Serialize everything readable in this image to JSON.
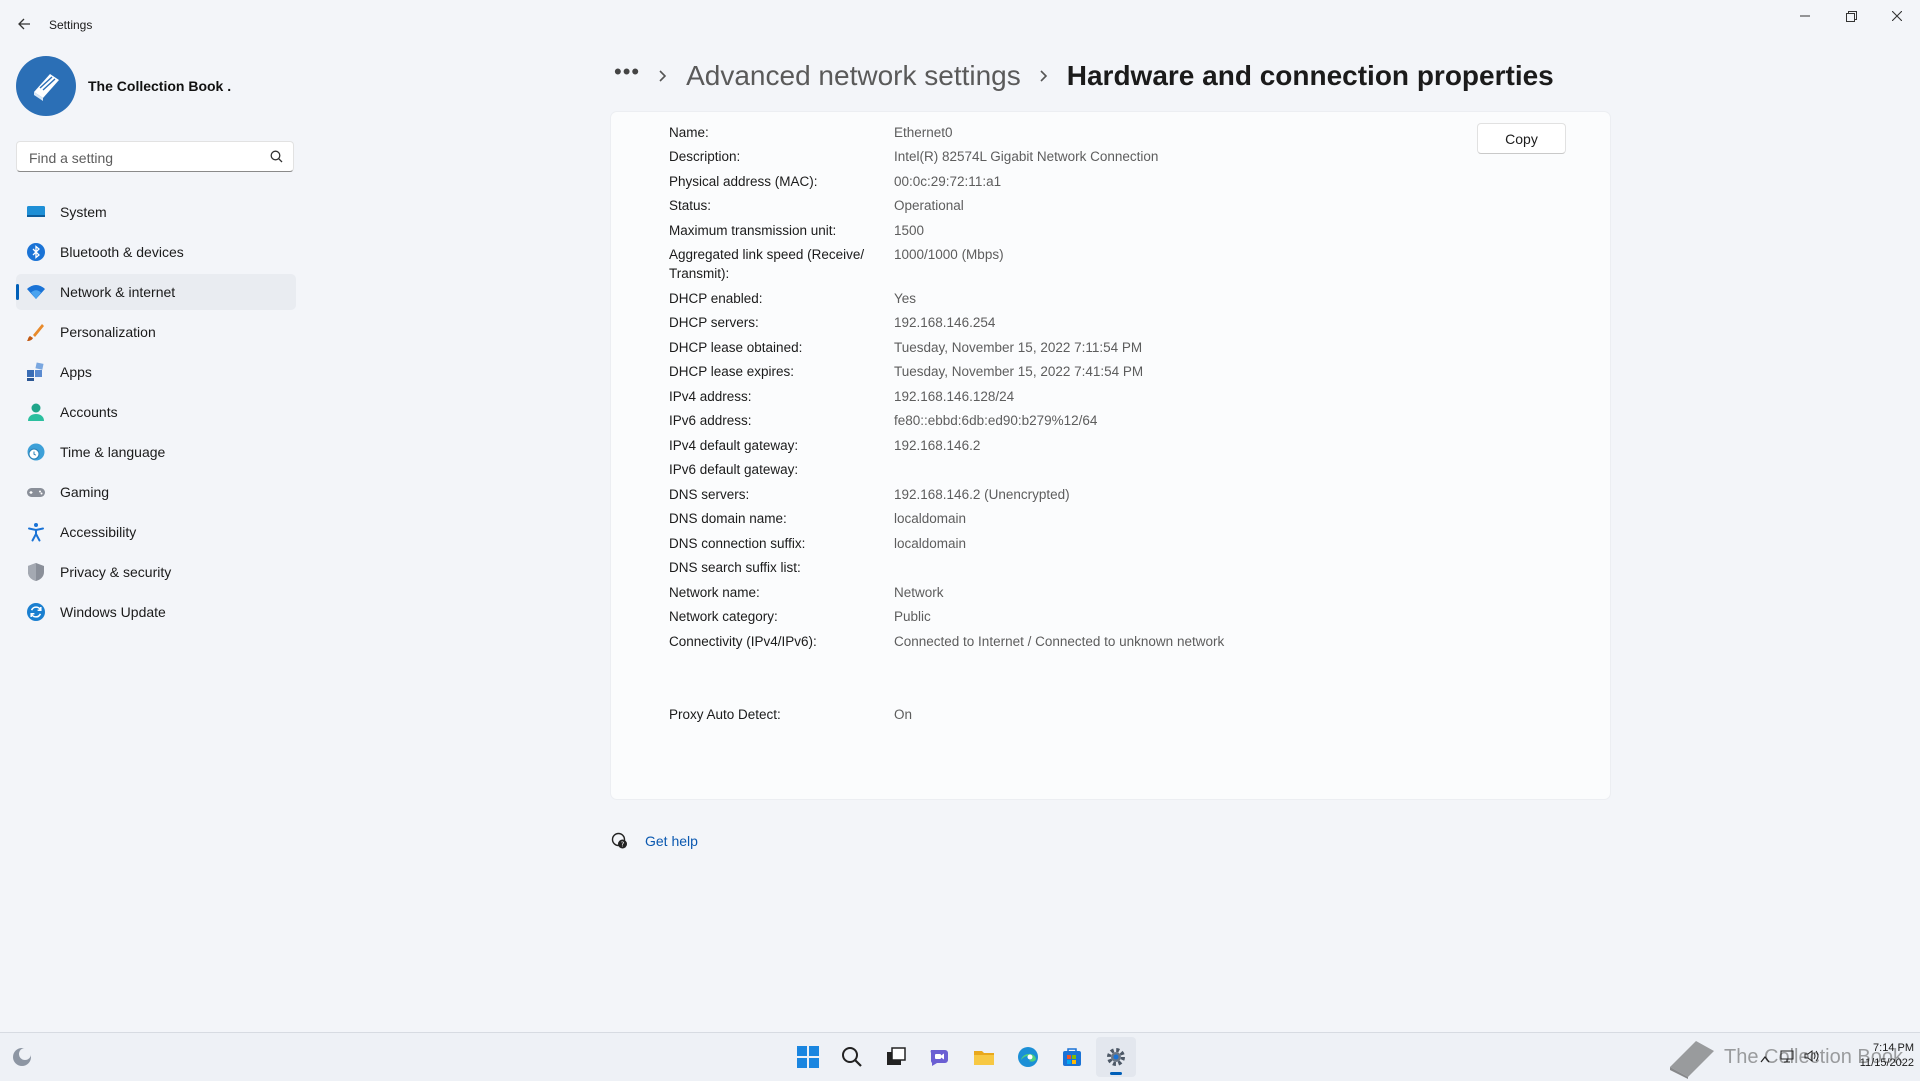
{
  "window": {
    "title": "Settings"
  },
  "profile": {
    "name": "The Collection Book ."
  },
  "search": {
    "placeholder": "Find a setting"
  },
  "sidebar": {
    "items": [
      {
        "label": "System",
        "icon": "system-icon"
      },
      {
        "label": "Bluetooth & devices",
        "icon": "bluetooth-icon"
      },
      {
        "label": "Network & internet",
        "icon": "wifi-icon",
        "active": true
      },
      {
        "label": "Personalization",
        "icon": "brush-icon"
      },
      {
        "label": "Apps",
        "icon": "apps-icon"
      },
      {
        "label": "Accounts",
        "icon": "account-icon"
      },
      {
        "label": "Time & language",
        "icon": "clock-globe-icon"
      },
      {
        "label": "Gaming",
        "icon": "gamepad-icon"
      },
      {
        "label": "Accessibility",
        "icon": "accessibility-icon"
      },
      {
        "label": "Privacy & security",
        "icon": "shield-icon"
      },
      {
        "label": "Windows Update",
        "icon": "update-icon"
      }
    ]
  },
  "breadcrumb": {
    "more": "•••",
    "parent": "Advanced network settings",
    "current": "Hardware and connection properties"
  },
  "properties": {
    "copy_label": "Copy",
    "rows": [
      {
        "label": "Name:",
        "value": "Ethernet0"
      },
      {
        "label": "Description:",
        "value": "Intel(R) 82574L Gigabit Network Connection"
      },
      {
        "label": "Physical address (MAC):",
        "value": "00:0c:29:72:11:a1"
      },
      {
        "label": "Status:",
        "value": "Operational"
      },
      {
        "label": "Maximum transmission unit:",
        "value": "1500"
      },
      {
        "label": "Aggregated link speed (Receive/\nTransmit):",
        "value": "1000/1000 (Mbps)"
      },
      {
        "label": "DHCP enabled:",
        "value": "Yes"
      },
      {
        "label": "DHCP servers:",
        "value": "192.168.146.254"
      },
      {
        "label": "DHCP lease obtained:",
        "value": "Tuesday, November 15, 2022 7:11:54 PM"
      },
      {
        "label": "DHCP lease expires:",
        "value": "Tuesday, November 15, 2022 7:41:54 PM"
      },
      {
        "label": "IPv4 address:",
        "value": "192.168.146.128/24"
      },
      {
        "label": "IPv6 address:",
        "value": "fe80::ebbd:6db:ed90:b279%12/64"
      },
      {
        "label": "IPv4 default gateway:",
        "value": "192.168.146.2"
      },
      {
        "label": "IPv6 default gateway:",
        "value": ""
      },
      {
        "label": "DNS servers:",
        "value": "192.168.146.2 (Unencrypted)"
      },
      {
        "label": "DNS domain name:",
        "value": "localdomain"
      },
      {
        "label": "DNS connection suffix:",
        "value": "localdomain"
      },
      {
        "label": "DNS search suffix list:",
        "value": ""
      },
      {
        "label": "Network name:",
        "value": "Network"
      },
      {
        "label": "Network category:",
        "value": "Public"
      },
      {
        "label": "Connectivity (IPv4/IPv6):",
        "value": "Connected to Internet / Connected to unknown network"
      }
    ],
    "proxy": {
      "label": "Proxy Auto Detect:",
      "value": "On"
    }
  },
  "help": {
    "label": "Get help"
  },
  "taskbar": {
    "apps": [
      "start-icon",
      "search-icon",
      "task-view-icon",
      "chat-icon",
      "file-explorer-icon",
      "edge-icon",
      "store-icon",
      "settings-icon"
    ],
    "watermark": "The Collection Book",
    "time": "7:14 PM",
    "date": "11/15/2022"
  },
  "colors": {
    "accent": "#005fb8",
    "link": "#0a58b0",
    "background": "#f3f5f9"
  }
}
